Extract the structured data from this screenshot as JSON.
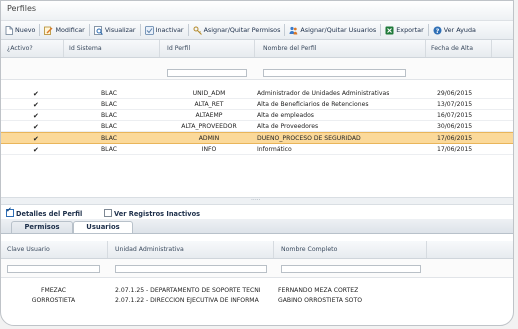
{
  "window": {
    "title": "Perfiles"
  },
  "toolbar": {
    "items": [
      {
        "label": "Nuevo",
        "icon": "new-doc-icon"
      },
      {
        "label": "Modificar",
        "icon": "edit-icon"
      },
      {
        "label": "Visualizar",
        "icon": "view-icon"
      },
      {
        "label": "Inactivar",
        "icon": "inactivate-icon"
      },
      {
        "label": "Asignar/Quitar Permisos",
        "icon": "permissions-icon"
      },
      {
        "label": "Asignar/Quitar Usuarios",
        "icon": "users-icon"
      },
      {
        "label": "Exportar",
        "icon": "excel-export-icon"
      },
      {
        "label": "Ver Ayuda",
        "icon": "help-icon"
      }
    ]
  },
  "grid1": {
    "headers": [
      "¿Activo?",
      "Id Sistema",
      "Id Perfil",
      "Nombre del Perfil",
      "Fecha de Alta"
    ],
    "rows": [
      {
        "activo": "✔",
        "sistema": "BLAC",
        "perfil": "UNID_ADM",
        "nombre": "Administrador de Unidades Administrativas",
        "fecha": "29/06/2015",
        "selected": false
      },
      {
        "activo": "✔",
        "sistema": "BLAC",
        "perfil": "ALTA_RET",
        "nombre": "Alta de Beneficiarios de Retenciones",
        "fecha": "13/07/2015",
        "selected": false
      },
      {
        "activo": "✔",
        "sistema": "BLAC",
        "perfil": "ALTAEMP",
        "nombre": "Alta de empleados",
        "fecha": "16/07/2015",
        "selected": false
      },
      {
        "activo": "✔",
        "sistema": "BLAC",
        "perfil": "ALTA_PROVEEDOR",
        "nombre": "Alta de Proveedores",
        "fecha": "30/06/2015",
        "selected": false
      },
      {
        "activo": "✔",
        "sistema": "BLAC",
        "perfil": "ADMIN",
        "nombre": "DUEÑO_PROCESO DE SEGURIDAD",
        "fecha": "17/06/2015",
        "selected": true
      },
      {
        "activo": "✔",
        "sistema": "BLAC",
        "perfil": "INFO",
        "nombre": "Informático",
        "fecha": "17/06/2015",
        "selected": false
      }
    ]
  },
  "splitter": {
    "grip": "....."
  },
  "detail": {
    "detalles_label": "Detalles del Perfil",
    "inactivos_label": "Ver Registros Inactivos",
    "tabs": [
      "Permisos",
      "Usuarios"
    ]
  },
  "grid2": {
    "headers": [
      "Clave Usuario",
      "Unidad Administrativa",
      "Nombre Completo"
    ],
    "rows": [
      {
        "clave": "FMEZAC",
        "unidad": "2.07.1.25 - DEPARTAMENTO DE SOPORTE TECNI",
        "nombre": "FERNANDO MEZA CORTEZ"
      },
      {
        "clave": "GORROSTIETA",
        "unidad": "2.07.1.22 - DIRECCION EJECUTIVA DE INFORMA",
        "nombre": "GABINO ORROSTIETA SOTO"
      }
    ]
  },
  "colors": {
    "selected_row": "#fbd99a",
    "accent": "#1d2f4a"
  }
}
